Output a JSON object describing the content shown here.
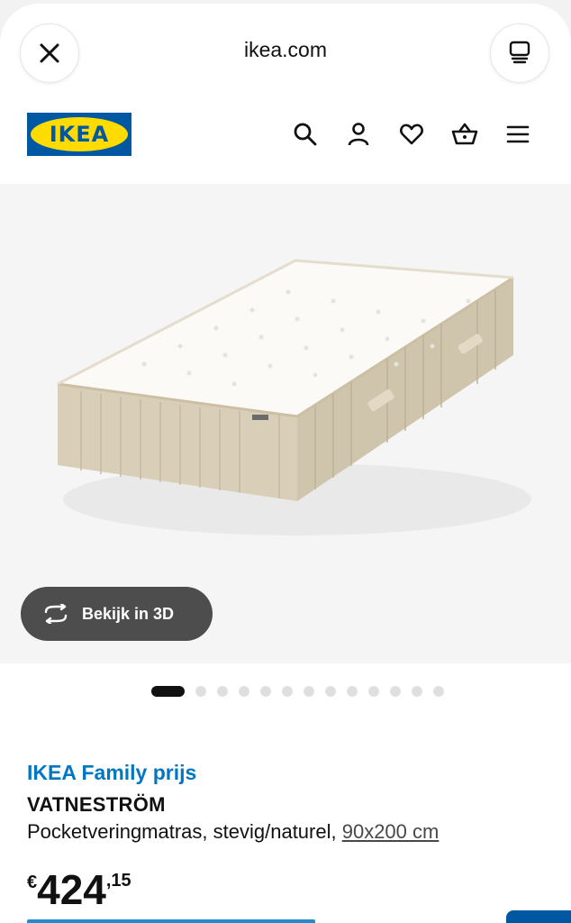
{
  "browser": {
    "url": "ikea.com",
    "close_icon": "close-icon",
    "tabs_icon": "tabs-icon"
  },
  "header": {
    "logo_text": "IKEA",
    "brand_colors": {
      "blue": "#0058a3",
      "yellow": "#ffdb00"
    },
    "icons": [
      "search-icon",
      "user-icon",
      "heart-icon",
      "cart-icon",
      "menu-icon"
    ]
  },
  "gallery": {
    "view_3d_label": "Bekijk in 3D",
    "image_count": 13,
    "active_index": 0
  },
  "product": {
    "family_label": "IKEA Family prijs",
    "name": "VATNESTRÖM",
    "description": "Pocketveringmatras, stevig/naturel, ",
    "size": "90x200 cm",
    "price_currency": "€",
    "price_int": "424",
    "price_dec": ",15",
    "accent_color": "#0077c1"
  }
}
